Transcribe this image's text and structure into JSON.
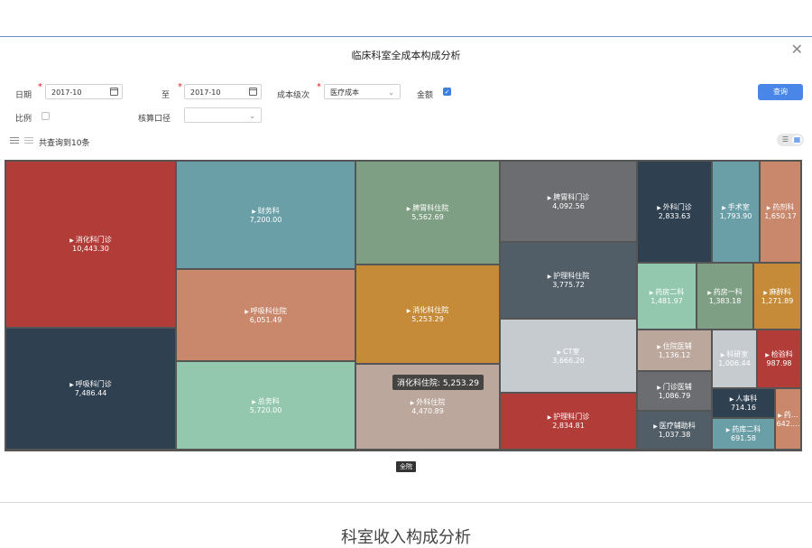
{
  "dialog": {
    "title": "临床科室全成本构成分析",
    "close_icon": "close-icon"
  },
  "filters": {
    "date_label": "日期",
    "date_from": "2017-10",
    "to_label": "至",
    "date_to": "2017-10",
    "cost_level_label": "成本级次",
    "cost_level_value": "医疗成本",
    "amount_label": "金额",
    "amount_checked": true,
    "ratio_label": "比例",
    "ratio_checked": false,
    "accounting_label": "核算口径",
    "accounting_value": ""
  },
  "query_button": "查询",
  "result_count": "共查询到10条",
  "tooltip": "消化科住院: 5,253.29",
  "breadcrumb": "全院",
  "caption": "科室收入构成分析",
  "colors": {
    "accent": "#4a86e8",
    "border": "#555555"
  },
  "treemap": [
    {
      "name": "消化科门诊",
      "value": "10,443.30",
      "color": "#b23c37"
    },
    {
      "name": "呼吸科门诊",
      "value": "7,486.44",
      "color": "#2f4051"
    },
    {
      "name": "财务科",
      "value": "7,200.00",
      "color": "#6b9fa8"
    },
    {
      "name": "呼吸科住院",
      "value": "6,051.49",
      "color": "#c9876c"
    },
    {
      "name": "总务科",
      "value": "5,720.00",
      "color": "#94c8ae"
    },
    {
      "name": "脾胃科住院",
      "value": "5,562.69",
      "color": "#7e9f84"
    },
    {
      "name": "消化科住院",
      "value": "5,253.29",
      "color": "#c68b39"
    },
    {
      "name": "外科住院",
      "value": "4,470.89",
      "color": "#bba79b"
    },
    {
      "name": "脾胃科门诊",
      "value": "4,092.56",
      "color": "#6c6d70"
    },
    {
      "name": "护理科住院",
      "value": "3,775.72",
      "color": "#525e67"
    },
    {
      "name": "CT室",
      "value": "3,666.20",
      "color": "#c6cbd0"
    },
    {
      "name": "护理科门诊",
      "value": "2,834.81",
      "color": "#b23c37"
    },
    {
      "name": "外科门诊",
      "value": "2,833.63",
      "color": "#2f4051"
    },
    {
      "name": "手术室",
      "value": "1,793.90",
      "color": "#6b9fa8"
    },
    {
      "name": "药剂科",
      "value": "1,650.17",
      "color": "#c9876c"
    },
    {
      "name": "药房二科",
      "value": "1,481.97",
      "color": "#94c8ae"
    },
    {
      "name": "药房一科",
      "value": "1,383.18",
      "color": "#7e9f84"
    },
    {
      "name": "麻醉科",
      "value": "1,271.89",
      "color": "#c68b39"
    },
    {
      "name": "住院医辅",
      "value": "1,136.12",
      "color": "#bba79b"
    },
    {
      "name": "科研室",
      "value": "1,006.44",
      "color": "#c6cbd0"
    },
    {
      "name": "检验科",
      "value": "987.98",
      "color": "#b23c37"
    },
    {
      "name": "门诊医辅",
      "value": "1,086.79",
      "color": "#6c6d70"
    },
    {
      "name": "人事科",
      "value": "714.16",
      "color": "#2f4051"
    },
    {
      "name": "医疗辅助科",
      "value": "1,037.38",
      "color": "#525e67"
    },
    {
      "name": "药库二科",
      "value": "691.58",
      "color": "#6b9fa8"
    },
    {
      "name": "药…",
      "value": "642.…",
      "color": "#c9876c"
    }
  ]
}
